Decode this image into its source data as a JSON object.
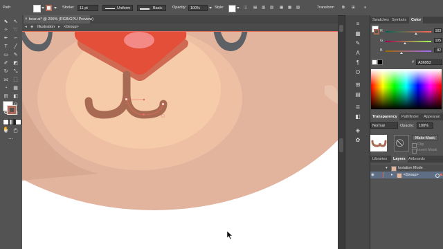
{
  "control_bar": {
    "selection_label": "Path",
    "stroke_label": "Stroke:",
    "stroke_weight": "11 pt",
    "profile_label": "Uniform",
    "brush_label": "Basic",
    "opacity_label": "Opacity:",
    "opacity_value": "100%",
    "style_label": "Style:",
    "transform_label": "Transform",
    "fill_color": "#ffffff",
    "stroke_color": "#b06a58"
  },
  "document": {
    "tab_title": "bear.ai* @ 200% (RGB/GPU Preview)",
    "breadcrumb": [
      "Illustration",
      "<Group>"
    ]
  },
  "color_panel": {
    "tabs": [
      "Swatches",
      "Symbols",
      "Color"
    ],
    "active_tab": "Color",
    "sliders": [
      {
        "label": "R",
        "value": "163"
      },
      {
        "label": "G",
        "value": "105"
      },
      {
        "label": "B",
        "value": "82"
      }
    ],
    "hex_label": "#",
    "hex_value": "A36952",
    "current_color": "#a36952"
  },
  "transparency_panel": {
    "tabs": [
      "Transparency",
      "Pathfinder",
      "Appearan"
    ],
    "active_tab": "Transparency",
    "blend_mode": "Normal",
    "opacity_label": "Opacity:",
    "opacity_value": "100%",
    "make_mask_label": "Make Mask",
    "clip_label": "Clip",
    "invert_mask_label": "Invert Mask"
  },
  "layers_panel": {
    "tabs": [
      "Libraries",
      "Layers",
      "Artboards"
    ],
    "active_tab": "Layers",
    "rows": [
      {
        "name": "Isolation Mode",
        "indent": 0
      },
      {
        "name": "<Group>",
        "indent": 1,
        "selected": true
      }
    ]
  },
  "colors": {
    "face": "#e2b49e",
    "face_shadow": "#d9a890",
    "muzzle_outer": "#efbfa4",
    "muzzle_inner": "#f6cba9",
    "nose": "#e34f38",
    "nose_shadow": "#d16a52",
    "nose_highlight": "#f38a86",
    "mouth": "#a86a53",
    "eye": "#5d6064",
    "selection": "#e26b5b"
  }
}
